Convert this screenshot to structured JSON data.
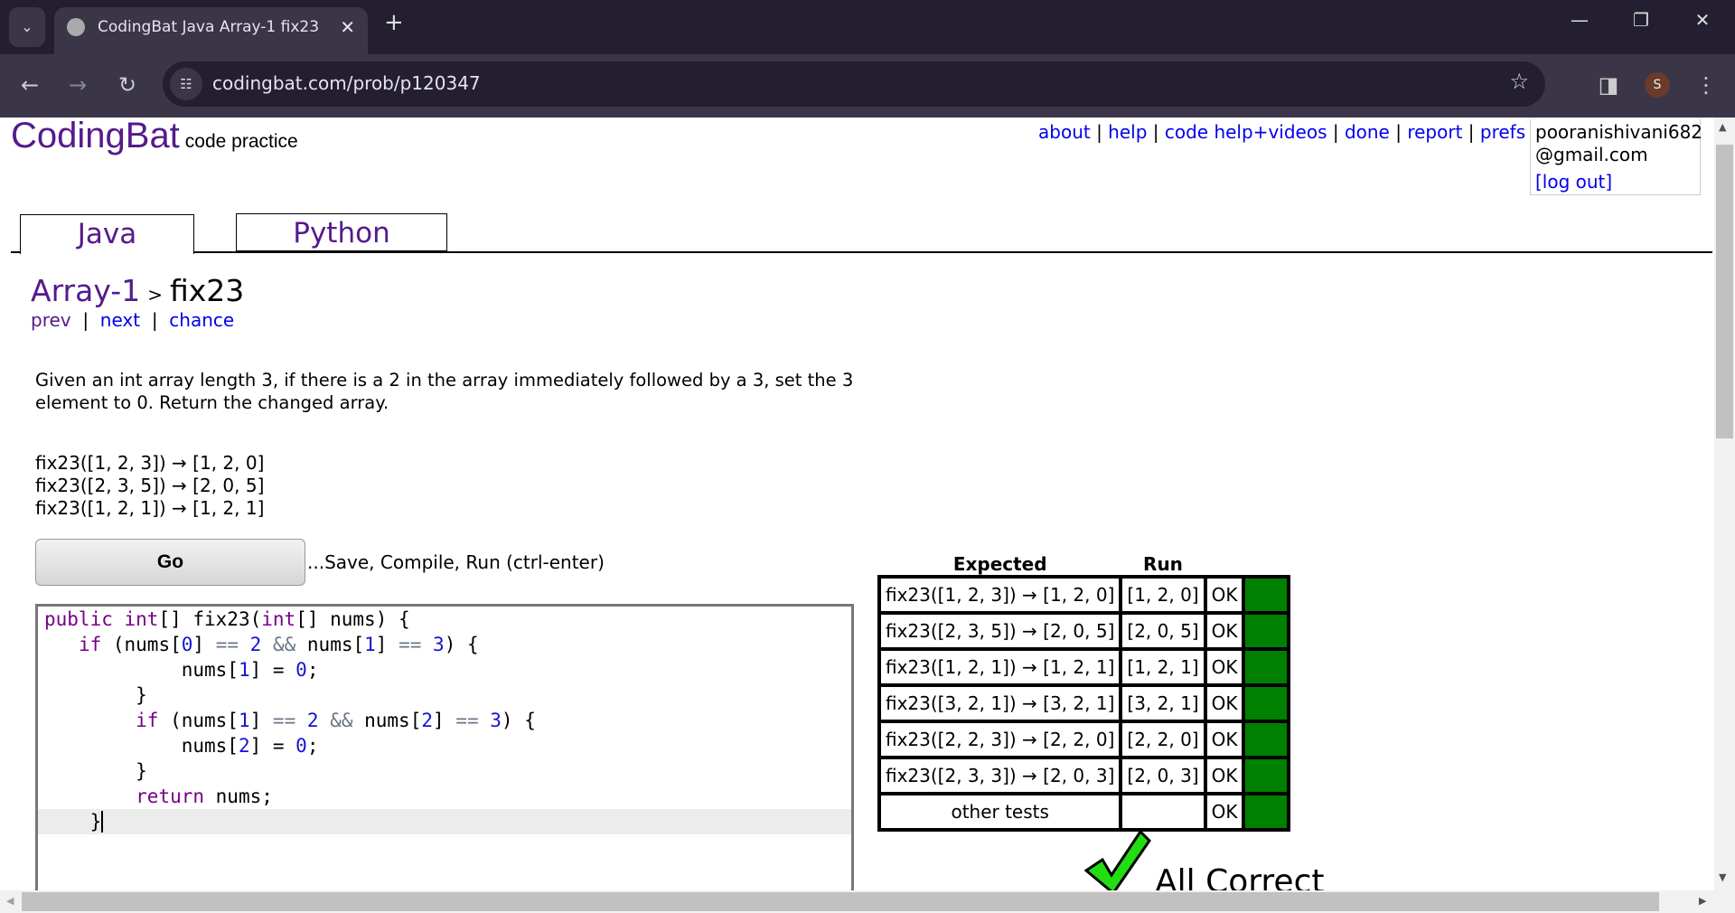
{
  "browser": {
    "tab_title": "CodingBat Java Array-1 fix23",
    "url": "codingbat.com/prob/p120347",
    "profile_initial": "S"
  },
  "site": {
    "logo": "CodingBat",
    "tagline": "code practice"
  },
  "nav": [
    "about",
    "help",
    "code help+videos",
    "done",
    "report",
    "prefs"
  ],
  "user": {
    "email_line1": "pooranishivani682",
    "email_line2": "@gmail.com",
    "logout": "[log out]"
  },
  "lang_tabs": [
    "Java",
    "Python"
  ],
  "breadcrumb": {
    "section": "Array-1",
    "sep": ">",
    "problem": "fix23"
  },
  "prob_nav": [
    "prev",
    "next",
    "chance"
  ],
  "description": "Given an int array length 3, if there is a 2 in the array immediately followed by a 3, set the 3 element to 0. Return the changed array.",
  "examples": [
    "fix23([1, 2, 3]) → [1, 2, 0]",
    "fix23([2, 3, 5]) → [2, 0, 5]",
    "fix23([1, 2, 1]) → [1, 2, 1]"
  ],
  "go": {
    "label": "Go",
    "hint": "...Save, Compile, Run (ctrl-enter)"
  },
  "code": [
    "public int[] fix23(int[] nums) {",
    "   if (nums[0] == 2 && nums[1] == 3) {",
    "            nums[1] = 0;",
    "        }",
    "        if (nums[1] == 2 && nums[2] == 3) {",
    "            nums[2] = 0;",
    "        }",
    "        return nums;",
    "    }"
  ],
  "results": {
    "headers": [
      "Expected",
      "Run"
    ],
    "rows": [
      {
        "expected": "fix23([1, 2, 3]) → [1, 2, 0]",
        "run": "[1, 2, 0]",
        "status": "OK"
      },
      {
        "expected": "fix23([2, 3, 5]) → [2, 0, 5]",
        "run": "[2, 0, 5]",
        "status": "OK"
      },
      {
        "expected": "fix23([1, 2, 1]) → [1, 2, 1]",
        "run": "[1, 2, 1]",
        "status": "OK"
      },
      {
        "expected": "fix23([3, 2, 1]) → [3, 2, 1]",
        "run": "[3, 2, 1]",
        "status": "OK"
      },
      {
        "expected": "fix23([2, 2, 3]) → [2, 2, 0]",
        "run": "[2, 2, 0]",
        "status": "OK"
      },
      {
        "expected": "fix23([2, 3, 3]) → [2, 0, 3]",
        "run": "[2, 0, 3]",
        "status": "OK"
      },
      {
        "expected": "other tests",
        "run": "",
        "status": "OK"
      }
    ],
    "pass_color": "#008000",
    "summary": "All Correct"
  }
}
